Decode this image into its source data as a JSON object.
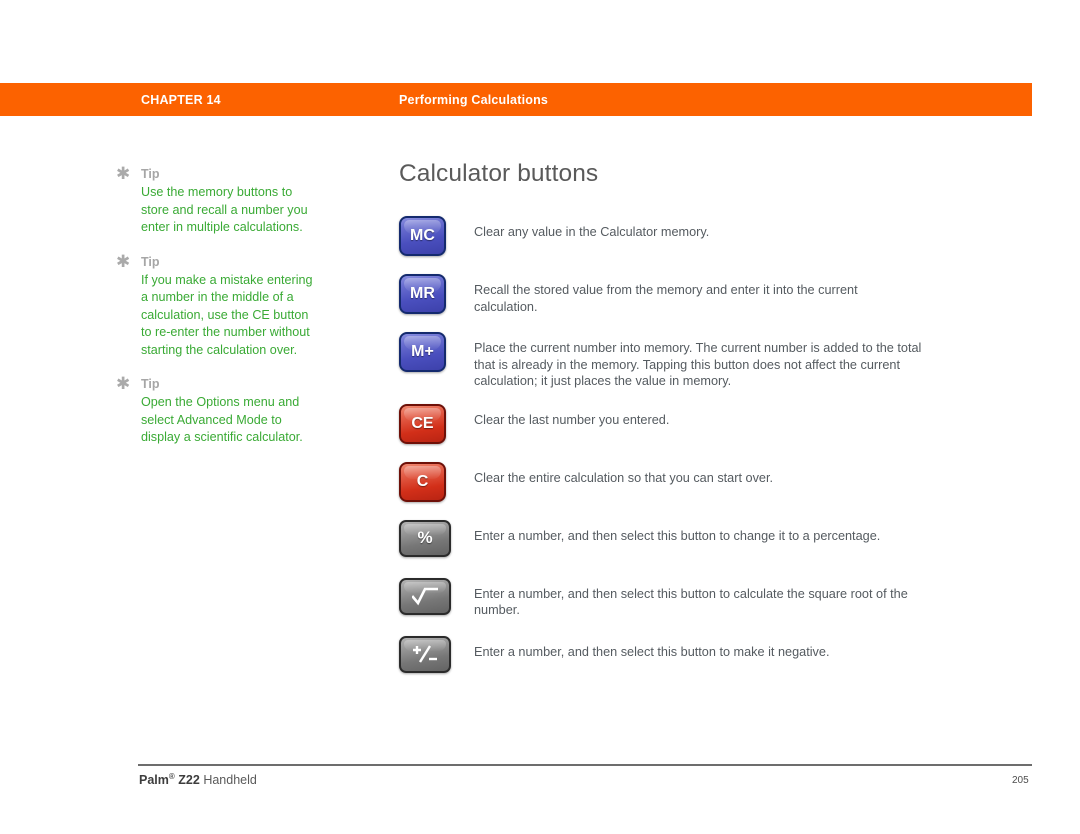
{
  "header": {
    "chapter": "CHAPTER 14",
    "section": "Performing Calculations",
    "bar_color": "#FC6200"
  },
  "sidebar": {
    "tip_label": "Tip",
    "asterisk_icon": "asterisk-icon",
    "text_color": "#3AAA35",
    "tips": [
      {
        "label": "Tip",
        "body": "Use the memory buttons to store and recall a number you enter in multiple calculations."
      },
      {
        "label": "Tip",
        "body": "If you make a mistake entering a number in the middle of a calculation, use the CE button to re-enter the number without starting the calculation over."
      },
      {
        "label": "Tip",
        "body": "Open the Options menu and select Advanced Mode to display a scientific calculator."
      }
    ]
  },
  "main": {
    "title": "Calculator buttons",
    "rows": [
      {
        "button_label": "MC",
        "button_style": "blue",
        "icon": "memory-clear-button",
        "description": "Clear any value in the Calculator memory."
      },
      {
        "button_label": "MR",
        "button_style": "blue",
        "icon": "memory-recall-button",
        "description": "Recall the stored value from the memory and enter it into the current calculation."
      },
      {
        "button_label": "M+",
        "button_style": "blue",
        "icon": "memory-add-button",
        "description": "Place the current number into memory. The current number is added to the total that is already in the memory. Tapping this button does not affect the current calculation; it just places the value in memory."
      },
      {
        "button_label": "CE",
        "button_style": "red",
        "icon": "clear-entry-button",
        "description": "Clear the last number you entered."
      },
      {
        "button_label": "C",
        "button_style": "red",
        "icon": "clear-all-button",
        "description": "Clear the entire calculation so that you can start over."
      },
      {
        "button_label": "%",
        "button_style": "gray",
        "icon": "percent-button",
        "description": "Enter a number, and then select this button to change it to a percentage."
      },
      {
        "button_label": "√",
        "button_style": "gray",
        "icon": "square-root-button",
        "description": "Enter a number, and then select this button to calculate the square root of the number."
      },
      {
        "button_label": "+/-",
        "button_style": "gray",
        "icon": "plus-minus-button",
        "description": "Enter a number, and then select this button to make it negative."
      }
    ]
  },
  "footer": {
    "brand": "Palm",
    "registered_mark": "®",
    "model": "Z22",
    "product": "Handheld",
    "page_number": "205"
  }
}
